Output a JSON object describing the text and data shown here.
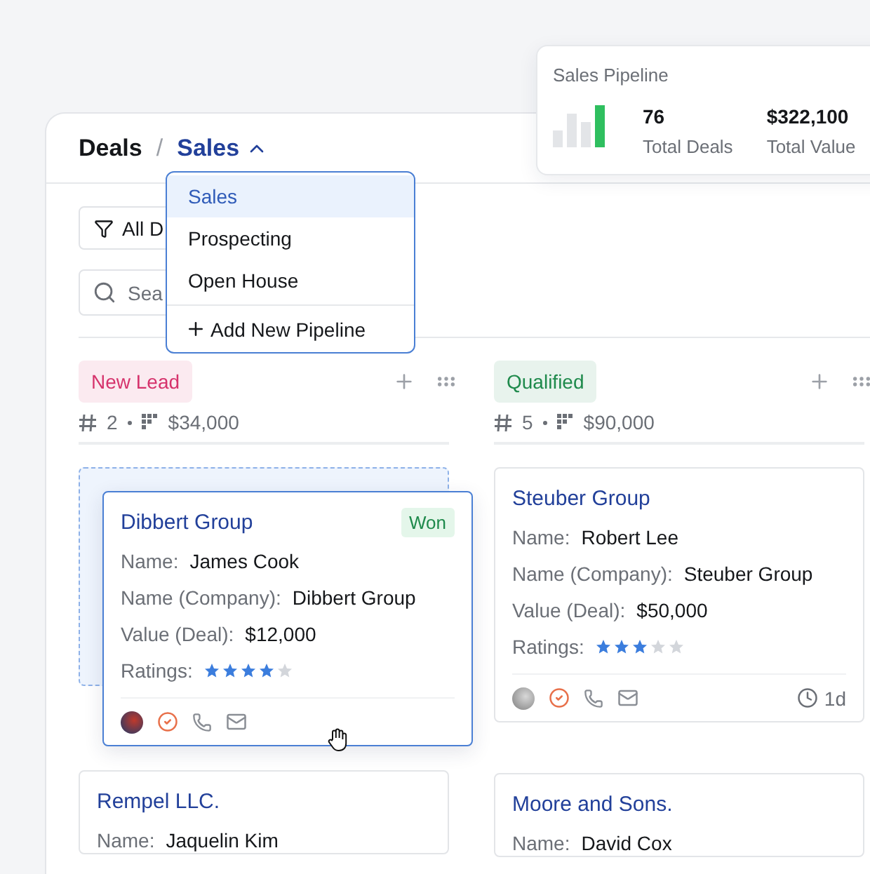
{
  "summary": {
    "title": "Sales Pipeline",
    "stats": [
      {
        "value": "76",
        "label": "Total Deals"
      },
      {
        "value": "$322,100",
        "label": "Total Value"
      }
    ]
  },
  "breadcrumb": {
    "root": "Deals",
    "separator": "/",
    "current": "Sales",
    "expanded": true
  },
  "pipeline_menu": {
    "items": [
      {
        "label": "Sales",
        "selected": true
      },
      {
        "label": "Prospecting",
        "selected": false
      },
      {
        "label": "Open House",
        "selected": false
      }
    ],
    "add_label": "Add New Pipeline"
  },
  "filter_button": {
    "label": "All D"
  },
  "search": {
    "placeholder": "Sea"
  },
  "columns": [
    {
      "title": "New Lead",
      "color": "#d6336c",
      "count": "2",
      "total": "$34,000",
      "cards": [
        {
          "title": "Dibbert Group",
          "badge": "Won",
          "dragging": true,
          "fields": [
            {
              "label": "Name:",
              "value": "James Cook"
            },
            {
              "label": "Name (Company):",
              "value": "Dibbert Group"
            },
            {
              "label": "Value (Deal):",
              "value": "$12,000"
            }
          ],
          "rating_label": "Ratings:",
          "stars": 4
        },
        {
          "title": "Rempel LLC.",
          "dragging": false,
          "fields": [
            {
              "label": "Name:",
              "value": "Jaquelin Kim"
            }
          ]
        }
      ]
    },
    {
      "title": "Qualified",
      "color": "#1f8a4c",
      "count": "5",
      "total": "$90,000",
      "cards": [
        {
          "title": "Steuber Group",
          "dragging": false,
          "fields": [
            {
              "label": "Name:",
              "value": "Robert Lee"
            },
            {
              "label": "Name (Company):",
              "value": "Steuber Group"
            },
            {
              "label": "Value (Deal):",
              "value": "$50,000"
            }
          ],
          "rating_label": "Ratings:",
          "stars": 3,
          "time": "1d"
        },
        {
          "title": "Moore and Sons.",
          "dragging": false,
          "fields": [
            {
              "label": "Name:",
              "value": "David Cox"
            }
          ]
        }
      ]
    }
  ]
}
